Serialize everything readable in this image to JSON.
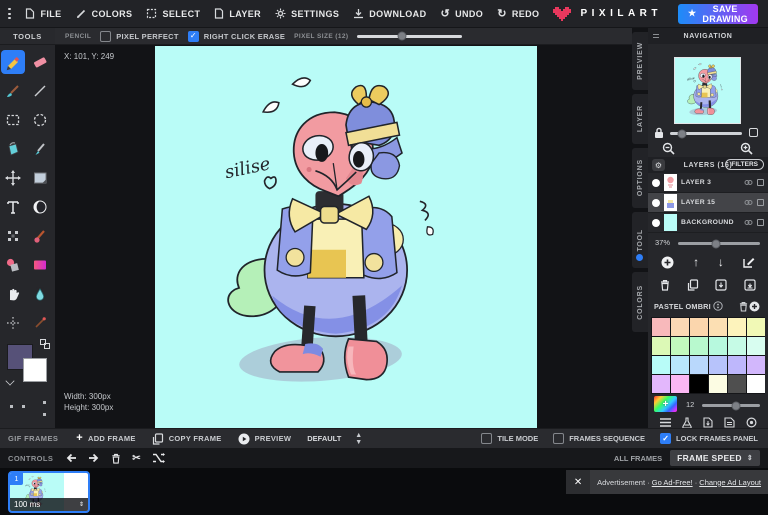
{
  "app": {
    "title": "PIXILART",
    "save_label": "SAVE DRAWING"
  },
  "menu": {
    "items": [
      {
        "label": "FILE",
        "icon": "file-icon"
      },
      {
        "label": "COLORS",
        "icon": "brush-icon"
      },
      {
        "label": "SELECT",
        "icon": "marquee-icon"
      },
      {
        "label": "LAYER",
        "icon": "layer-icon"
      },
      {
        "label": "SETTINGS",
        "icon": "gear-icon"
      },
      {
        "label": "DOWNLOAD",
        "icon": "download-icon"
      },
      {
        "label": "UNDO",
        "icon": "undo-icon"
      },
      {
        "label": "REDO",
        "icon": "redo-icon"
      }
    ]
  },
  "tool_options": {
    "tool_label": "PENCIL",
    "pixel_perfect_label": "PIXEL PERFECT",
    "pixel_perfect_checked": false,
    "right_click_erase_label": "RIGHT CLICK ERASE",
    "right_click_erase_checked": true,
    "pixel_size_label": "PIXEL SIZE (12)",
    "pixel_size_value": 12
  },
  "tools_panel": {
    "title": "TOOLS",
    "selected_tool": "pencil",
    "tools": [
      "pencil",
      "eraser",
      "brush",
      "line",
      "rect-select",
      "lasso-select",
      "bucket",
      "eyedropper",
      "move",
      "select-area",
      "text",
      "shape",
      "dither",
      "stamp",
      "replace-color",
      "gradient",
      "pan",
      "blur",
      "lighten"
    ],
    "primary_color": "#565178",
    "secondary_color": "#ffffff"
  },
  "canvas": {
    "cursor_position": "X: 101, Y: 249",
    "width_label": "Width: 300px",
    "height_label": "Height: 300px",
    "background_color": "#b9fcf7",
    "artwork_signature": "silise"
  },
  "right_panel": {
    "tabs": [
      "PREVIEW",
      "LAYER",
      "OPTIONS",
      "TOOL",
      "COLORS"
    ],
    "navigation_title": "NAVIGATION",
    "layers": {
      "header": "LAYERS (16)",
      "filters_label": "FILTERS",
      "opacity": "37%",
      "items": [
        {
          "name": "LAYER 3",
          "selected": false
        },
        {
          "name": "LAYER 15",
          "selected": true
        },
        {
          "name": "BACKGROUND",
          "selected": false
        }
      ]
    },
    "palette": {
      "name": "PASTEL OMBRI",
      "swatch_size_value": "12",
      "colors": [
        "#f8b9bb",
        "#fbd8b4",
        "#fbd6ad",
        "#fcdfb3",
        "#fdf3bc",
        "#f1f9b6",
        "#dcf9b6",
        "#c3f9bd",
        "#b8f9ce",
        "#b7f9de",
        "#c6fbe6",
        "#d8fdf0",
        "#b8fcf8",
        "#b8e7fc",
        "#b9d8fc",
        "#b7c3fb",
        "#beb7fc",
        "#d2b7fc",
        "#e3b7fc",
        "#fbb7f3",
        "#000000",
        "#fcfce3",
        "#4f4f4f",
        "#ffffff"
      ]
    }
  },
  "frames_bar": {
    "title": "GIF FRAMES",
    "add_frame_label": "ADD FRAME",
    "copy_frame_label": "COPY FRAME",
    "preview_label": "PREVIEW",
    "mode_value": "DEFAULT",
    "tile_mode_label": "TILE MODE",
    "tile_mode_checked": false,
    "frames_sequence_label": "FRAMES SEQUENCE",
    "frames_sequence_checked": false,
    "lock_frames_label": "LOCK FRAMES PANEL",
    "lock_frames_checked": true
  },
  "controls_bar": {
    "title": "CONTROLS",
    "all_frames_label": "ALL FRAMES",
    "frame_speed_label": "FRAME SPEED"
  },
  "frames": {
    "items": [
      {
        "number": "1",
        "duration": "100 ms"
      }
    ]
  },
  "ad_bar": {
    "text": "Advertisement",
    "separator": "·",
    "link_ad_free": "Go Ad-Free!",
    "link_change_layout": "Change Ad Layout"
  },
  "colors": {
    "accent": "#2e7ef7",
    "save_gradient_start": "#1d8cf8",
    "save_gradient_end": "#a238f0",
    "logo_heart": "#e8385d",
    "panel_bg": "#26272b",
    "workspace_bg": "#121316"
  }
}
